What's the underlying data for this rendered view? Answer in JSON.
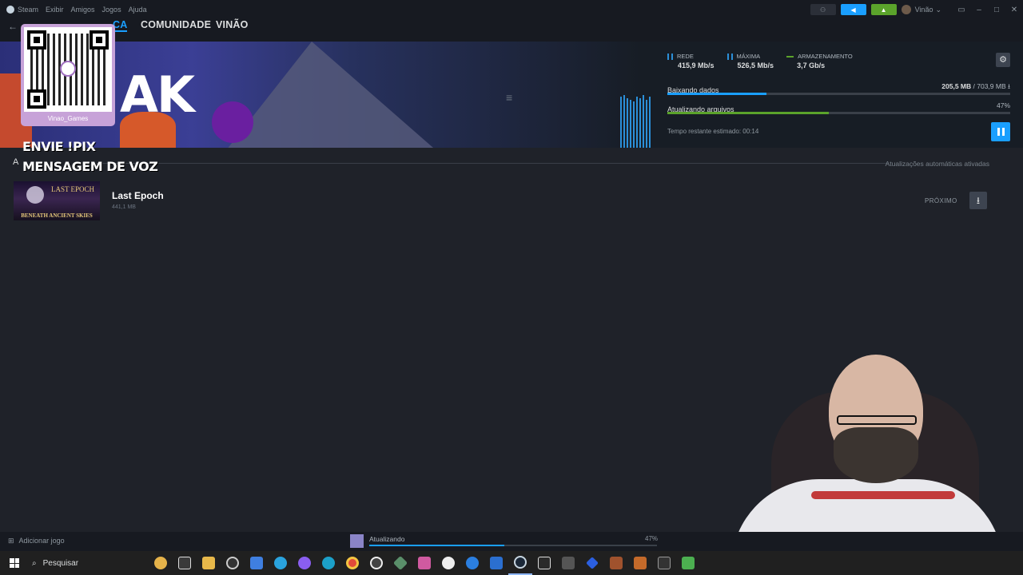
{
  "menubar": {
    "items": [
      "Steam",
      "Exibir",
      "Amigos",
      "Jogos",
      "Ajuda"
    ],
    "user": "Vinão",
    "user_chevron": "⌄"
  },
  "nav": {
    "back": "←",
    "active_partial": "CA",
    "community": "COMUNIDADE",
    "profile": "VINÃO"
  },
  "stats": {
    "network_label": "REDE",
    "network_value": "415,9 Mb/s",
    "peak_label": "MÁXIMA",
    "peak_value": "526,5 Mb/s",
    "storage_label": "ARMAZENAMENTO",
    "storage_value": "3,7 Gb/s"
  },
  "downloading": {
    "label": "Baixando dados",
    "done": "205,5 MB",
    "separator": " / ",
    "total": "703,9 MB",
    "fraction": 0.29
  },
  "updating": {
    "label": "Atualizando arquivos",
    "percent": "47%",
    "fraction": 0.47
  },
  "eta": "Tempo restante estimado: 00:14",
  "section": {
    "letter": "A",
    "auto_updates": "Atualizações automáticas ativadas"
  },
  "game": {
    "name": "Last Epoch",
    "size": "441,1 MB",
    "capsule_title": "LAST EPOCH",
    "capsule_subtitle": "BENEATH ANCIENT SKIES",
    "next_label": "PRÓXIMO"
  },
  "overlay": {
    "qr_name": "Vinao_Games",
    "pix_line1": "ENVIE !PIX",
    "pix_line2": "MENSAGEM DE VOZ"
  },
  "statusbar": {
    "add_game": "Adicionar jogo",
    "updating": "Atualizando",
    "percent": "47%"
  },
  "taskbar": {
    "search": "Pesquisar"
  },
  "colors": {
    "accent": "#1a9fff",
    "green": "#5ba32b"
  },
  "icons": {
    "settings": "gear-icon",
    "pause": "pause-icon",
    "download": "download-icon",
    "menu": "hamburger-icon"
  }
}
